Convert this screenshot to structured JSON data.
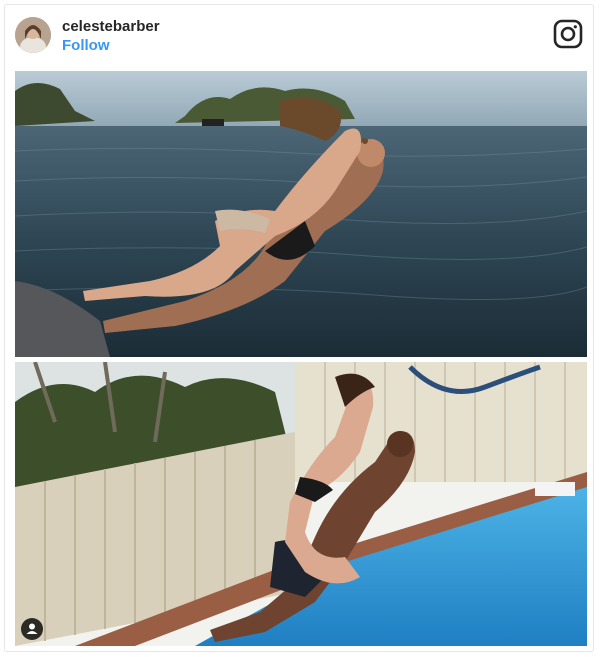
{
  "post": {
    "username": "celestebarber",
    "follow_label": "Follow"
  },
  "icons": {
    "brand": "instagram-icon",
    "tag": "user-tag-icon"
  },
  "colors": {
    "follow": "#3897f0",
    "text": "#262626",
    "border": "#e6e6e6"
  }
}
